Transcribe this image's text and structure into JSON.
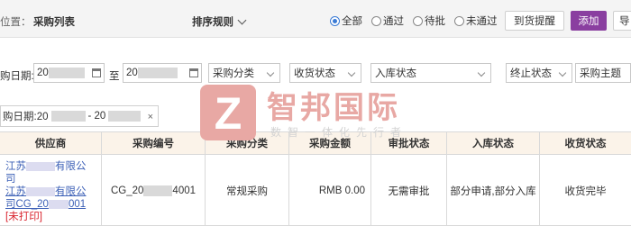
{
  "header": {
    "breadcrumb_label": "位置：",
    "page_title": "采购列表",
    "sort_label": "排序规则",
    "radios": [
      {
        "label": "全部",
        "checked": true
      },
      {
        "label": "通过",
        "checked": false
      },
      {
        "label": "待批",
        "checked": false
      },
      {
        "label": "未通过",
        "checked": false
      }
    ],
    "buttons": {
      "arrival_reminder": "到货提醒",
      "add": "添加",
      "export": "导"
    }
  },
  "filters": {
    "purchase_date_label": "购日期:",
    "date_from": "20",
    "date_to_label": "至",
    "date_to": "20",
    "category": "采购分类",
    "receive_status": "收货状态",
    "stock_status": "入库状态",
    "stop_status": "终止状态",
    "purchase_subject": "采购主题"
  },
  "active_filter": {
    "label": "购日期:20",
    "separator": "- 20",
    "close": "×"
  },
  "table": {
    "columns": [
      "供应商",
      "采购编号",
      "采购分类",
      "采购金额",
      "审批状态",
      "入库状态",
      "收货状态"
    ],
    "rows": [
      {
        "supplier_line1_a": "江苏",
        "supplier_line1_b": "有限公",
        "supplier_line2": "司",
        "supplier_line3_a": "江苏",
        "supplier_line3_b": "有限公",
        "supplier_line4_a": "司CG_20",
        "supplier_line4_b": "001",
        "print_status": "[未打印]",
        "order_no_a": "CG_20",
        "order_no_b": "4001",
        "category": "常规采购",
        "amount": "RMB 0.00",
        "approval": "无需审批",
        "stock": "部分申请,部分入库",
        "receive": "收货完毕"
      }
    ]
  },
  "watermark": {
    "logo_letter": "Z",
    "brand": "智邦国际",
    "slogan": "数智一体化先行者"
  },
  "colors": {
    "accent": "#8a3fa0",
    "link": "#3b5fb6",
    "alert": "#d9232d",
    "header_bg": "#fbf3e9"
  }
}
